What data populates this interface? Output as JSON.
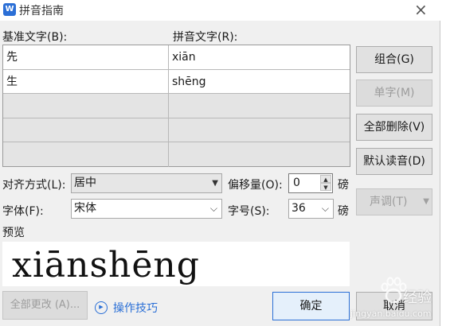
{
  "window": {
    "title": "拼音指南",
    "app_icon": "W"
  },
  "labels": {
    "base_text": "基准文字(B):",
    "ruby_text": "拼音文字(R):",
    "alignment": "对齐方式(L):",
    "offset": "偏移量(O):",
    "font": "字体(F):",
    "size": "字号(S):",
    "preview": "预览",
    "unit_offset": "磅",
    "unit_size": "磅"
  },
  "rows": [
    {
      "base": "先",
      "ruby": "xiān"
    },
    {
      "base": "生",
      "ruby": "shēng"
    },
    {
      "base": "",
      "ruby": ""
    },
    {
      "base": "",
      "ruby": ""
    },
    {
      "base": "",
      "ruby": ""
    }
  ],
  "controls": {
    "alignment_value": "居中",
    "offset_value": "0",
    "font_value": "宋体",
    "size_value": "36"
  },
  "buttons": {
    "group": "组合(G)",
    "single": "单字(M)",
    "delete_all": "全部删除(V)",
    "default_reading": "默认读音(D)",
    "tone": "声调(T)",
    "change_all": "全部更改 (A)...",
    "ok": "确定",
    "cancel": "取消"
  },
  "preview_text": "xiānshēng",
  "tips_link": "操作技巧",
  "watermark": {
    "brand": "经验",
    "url": "jingyan.baidu.com"
  },
  "colors": {
    "accent": "#2a6fd6",
    "dialog_bg": "#f0f0f0"
  }
}
